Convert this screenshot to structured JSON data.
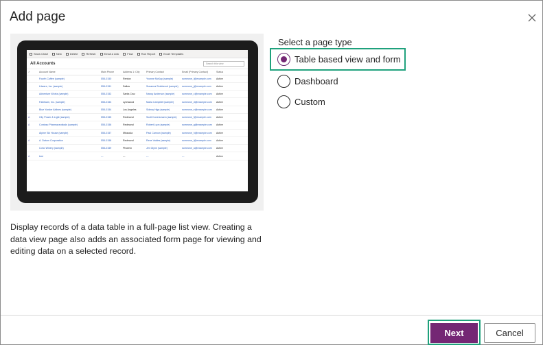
{
  "dialog": {
    "title": "Add page",
    "close_icon": "close-icon"
  },
  "page_type": {
    "label": "Select a page type",
    "options": [
      {
        "label": "Table based view and form",
        "selected": true
      },
      {
        "label": "Dashboard",
        "selected": false
      },
      {
        "label": "Custom",
        "selected": false
      }
    ]
  },
  "description": "Display records of a data table in a full-page list view. Creating a data view page also adds an associated form page for viewing and editing data on a selected record.",
  "preview": {
    "commands": [
      "Show Chart",
      "New",
      "Delete",
      "Refresh",
      "Email a Link",
      "Flow",
      "Run Report",
      "Excel Templates"
    ],
    "view_title": "All Accounts",
    "search_placeholder": "Search this view",
    "columns": [
      "Account Name",
      "Main Phone",
      "Address 1: City",
      "Primary Contact",
      "Email (Primary Contact)",
      "Status"
    ],
    "rows": [
      {
        "icon": "",
        "name": "Fourth Coffee (sample)",
        "phone": "555-0150",
        "city": "Renton",
        "contact": "Yvonne McKay (sample)",
        "email": "someone_i@example.com",
        "status": "Active"
      },
      {
        "icon": "",
        "name": "Litware, Inc. (sample)",
        "phone": "555-0151",
        "city": "Dallas",
        "contact": "Susanna Stubberod (sample)",
        "email": "someone_j@example.com",
        "status": "Active"
      },
      {
        "icon": "",
        "name": "Adventure Works (sample)",
        "phone": "555-0152",
        "city": "Santa Cruz",
        "contact": "Nancy Anderson (sample)",
        "email": "someone_c@example.com",
        "status": "Active"
      },
      {
        "icon": "",
        "name": "Fabrikam, Inc. (sample)",
        "phone": "555-0153",
        "city": "Lynnwood",
        "contact": "Maria Campbell (sample)",
        "email": "someone_d@example.com",
        "status": "Active"
      },
      {
        "icon": "",
        "name": "Blue Yonder Airlines (sample)",
        "phone": "555-0154",
        "city": "Los Angeles",
        "contact": "Sidney Higa (sample)",
        "email": "someone_e@example.com",
        "status": "Active"
      },
      {
        "icon": "A",
        "name": "City Power & Light (sample)",
        "phone": "555-0155",
        "city": "Redmond",
        "contact": "Scott Konersmann (sample)",
        "email": "someone_f@example.com",
        "status": "Active"
      },
      {
        "icon": "A",
        "name": "Contoso Pharmaceuticals (sample)",
        "phone": "555-0156",
        "city": "Redmond",
        "contact": "Robert Lyon (sample)",
        "email": "someone_g@example.com",
        "status": "Active"
      },
      {
        "icon": "",
        "name": "Alpine Ski House (sample)",
        "phone": "555-0157",
        "city": "Missoula",
        "contact": "Paul Cannon (sample)",
        "email": "someone_h@example.com",
        "status": "Active"
      },
      {
        "icon": "A",
        "name": "A. Datum Corporation",
        "phone": "555-0158",
        "city": "Redmond",
        "contact": "Rene Valdes (sample)",
        "email": "someone_i@example.com",
        "status": "Active"
      },
      {
        "icon": "",
        "name": "Coho Winery (sample)",
        "phone": "555-0159",
        "city": "Phoenix",
        "contact": "Jim Glynn (sample)",
        "email": "someone_a@example.com",
        "status": "Active"
      },
      {
        "icon": "A",
        "name": "test",
        "phone": "---",
        "city": "---",
        "contact": "---",
        "email": "---",
        "status": "Active"
      }
    ]
  },
  "footer": {
    "next_label": "Next",
    "cancel_label": "Cancel"
  },
  "colors": {
    "primary": "#742774",
    "focus_outline": "#1fa17c"
  }
}
